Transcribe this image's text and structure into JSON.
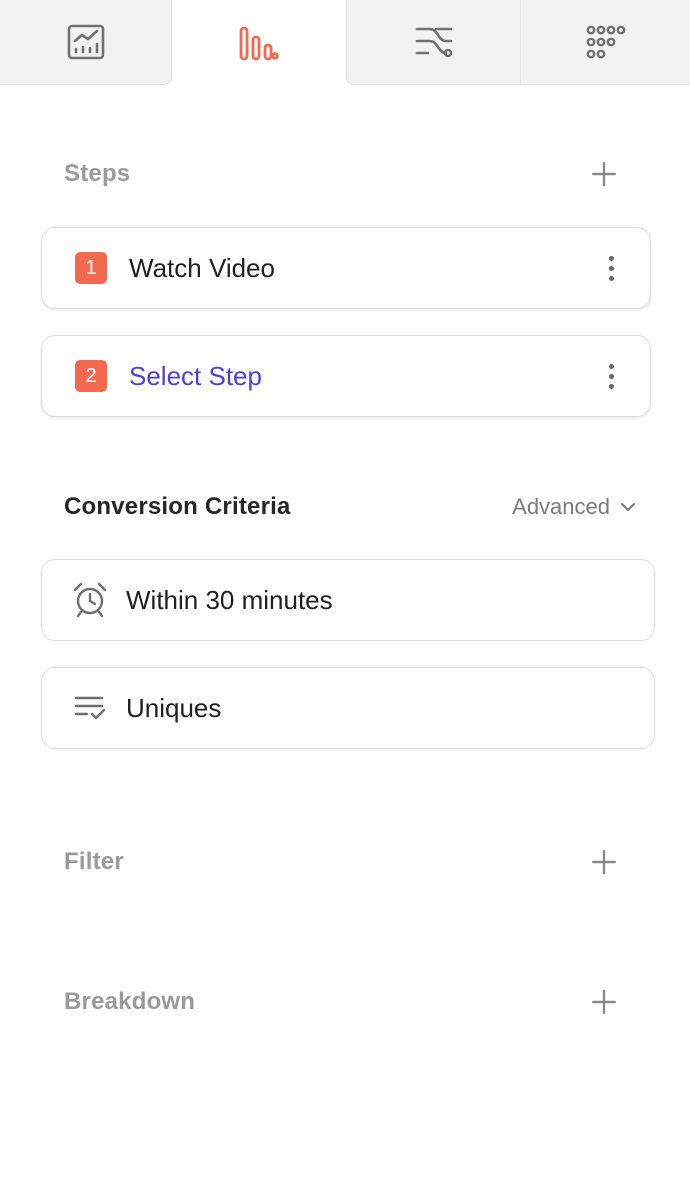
{
  "tabs": [
    {
      "icon": "insights-chart-icon",
      "active": false
    },
    {
      "icon": "funnel-bars-icon",
      "active": true
    },
    {
      "icon": "flows-icon",
      "active": false
    },
    {
      "icon": "retention-grid-icon",
      "active": false
    }
  ],
  "steps": {
    "title": "Steps",
    "items": [
      {
        "number": "1",
        "label": "Watch Video"
      },
      {
        "number": "2",
        "label": "Select Step"
      }
    ]
  },
  "conversion": {
    "title": "Conversion Criteria",
    "advanced_label": "Advanced",
    "window_label": "Within 30 minutes",
    "counting_label": "Uniques"
  },
  "filter": {
    "title": "Filter"
  },
  "breakdown": {
    "title": "Breakdown"
  },
  "colors": {
    "accent": "#f26950",
    "link": "#4b3fd6",
    "muted_text": "#9a9a9a"
  }
}
